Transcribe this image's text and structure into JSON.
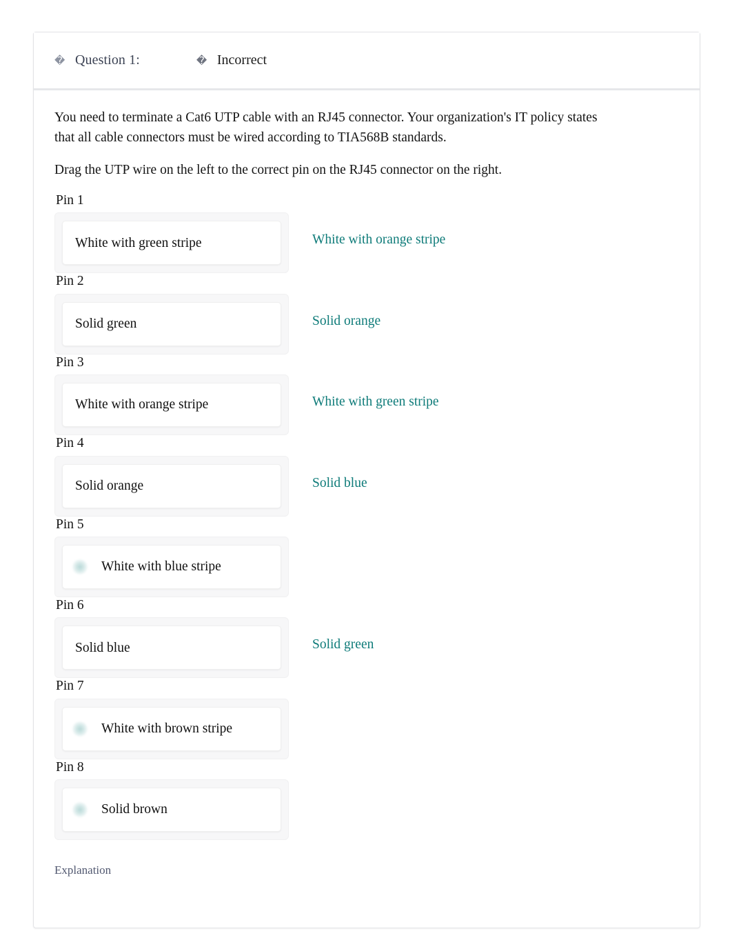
{
  "header": {
    "question_icon": "�",
    "question_label": "Question 1:",
    "status_icon": "�",
    "status_label": "Incorrect"
  },
  "question": {
    "stem": "You need to terminate a Cat6 UTP cable with an RJ45 connector. Your organization's IT policy states that all cable connectors must be wired according to TIA568B standards.",
    "instruction": "Drag the UTP wire on the left to the correct pin on the RJ45 connector on the right."
  },
  "pins": [
    {
      "label": "Pin 1",
      "placed_wire": "White with green stripe",
      "correct_answer": "White with orange stripe",
      "is_correct": false
    },
    {
      "label": "Pin 2",
      "placed_wire": "Solid green",
      "correct_answer": "Solid orange",
      "is_correct": false
    },
    {
      "label": "Pin 3",
      "placed_wire": "White with orange stripe",
      "correct_answer": "White with green stripe",
      "is_correct": false
    },
    {
      "label": "Pin 4",
      "placed_wire": "Solid orange",
      "correct_answer": "Solid blue",
      "is_correct": false
    },
    {
      "label": "Pin 5",
      "placed_wire": "White with blue stripe",
      "correct_answer": "",
      "is_correct": true
    },
    {
      "label": "Pin 6",
      "placed_wire": "Solid blue",
      "correct_answer": "Solid green",
      "is_correct": false
    },
    {
      "label": "Pin 7",
      "placed_wire": "White with brown stripe",
      "correct_answer": "",
      "is_correct": true
    },
    {
      "label": "Pin 8",
      "placed_wire": "Solid brown",
      "correct_answer": "",
      "is_correct": true
    }
  ],
  "footer": {
    "explanation_label": "Explanation"
  },
  "colors": {
    "correct_answer_text": "#0e7b79",
    "question_label_text": "#3c4354",
    "explanation_text": "#515870",
    "body_text": "#141414",
    "drop_zone_bg": "#f7f7f8",
    "tile_bg": "#ffffff"
  }
}
